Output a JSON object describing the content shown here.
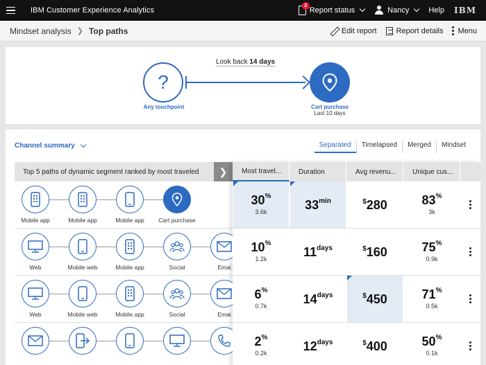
{
  "topbar": {
    "brand_prefix": "IBM",
    "brand_name": "Customer Experience Analytics",
    "report_status": "Report status",
    "report_badge": "2",
    "user": "Nancy",
    "help": "Help",
    "logo": "IBM"
  },
  "subbar": {
    "crumb_parent": "Mindset analysis",
    "crumb_current": "Top paths",
    "edit_report": "Edit report",
    "report_details": "Report details",
    "menu": "Menu"
  },
  "config": {
    "lookback_prefix": "Look back",
    "lookback_value": "14 days",
    "start_label": "Any touchpoint",
    "start_symbol": "?",
    "end_label": "Cart purchase",
    "end_sub": "Last 10 days"
  },
  "summary": {
    "title": "Channel summary",
    "views": [
      "Separated",
      "Timelapsed",
      "Merged",
      "Mindset"
    ],
    "left_header": "Top 5 paths of dynamic segment ranked by most traveled",
    "columns": [
      "Most travel...",
      "Duration",
      "Avg revenu...",
      "Unique cus..."
    ],
    "paths": [
      {
        "nodes": [
          {
            "label": "Mobile app",
            "icon": "mobile-icon"
          },
          {
            "label": "Mobile app",
            "icon": "mobile-icon"
          },
          {
            "label": "Mobile app",
            "icon": "phone-icon"
          },
          {
            "label": "Cart purchase",
            "icon": "location-pin-icon"
          }
        ],
        "traveled": "30",
        "traveled_unit": "%",
        "traveled_count": "3.6k",
        "duration": "33",
        "duration_unit": "min",
        "revenue_cur": "$",
        "revenue": "280",
        "unique": "83",
        "unique_unit": "%",
        "unique_count": "3k"
      },
      {
        "nodes": [
          {
            "label": "Web",
            "icon": "monitor-icon"
          },
          {
            "label": "Mobile web",
            "icon": "phone-icon"
          },
          {
            "label": "Mobile app",
            "icon": "mobile-icon"
          },
          {
            "label": "Social",
            "icon": "people-icon"
          },
          {
            "label": "Emai",
            "icon": "envelope-icon"
          }
        ],
        "traveled": "10",
        "traveled_unit": "%",
        "traveled_count": "1.2k",
        "duration": "11",
        "duration_unit": "days",
        "revenue_cur": "$",
        "revenue": "160",
        "unique": "75",
        "unique_unit": "%",
        "unique_count": "0.9k"
      },
      {
        "nodes": [
          {
            "label": "Web",
            "icon": "monitor-icon"
          },
          {
            "label": "Mobile web",
            "icon": "phone-icon"
          },
          {
            "label": "Mobile app",
            "icon": "mobile-icon"
          },
          {
            "label": "Social",
            "icon": "people-icon"
          },
          {
            "label": "Emai",
            "icon": "envelope-icon"
          }
        ],
        "traveled": "6",
        "traveled_unit": "%",
        "traveled_count": "0.7k",
        "duration": "14",
        "duration_unit": "days",
        "revenue_cur": "$",
        "revenue": "450",
        "unique": "71",
        "unique_unit": "%",
        "unique_count": "0.5k"
      },
      {
        "nodes": [
          {
            "label": "",
            "icon": "envelope-icon"
          },
          {
            "label": "",
            "icon": "phone-exit-icon"
          },
          {
            "label": "",
            "icon": "phone-icon"
          },
          {
            "label": "",
            "icon": "monitor-icon"
          },
          {
            "label": "",
            "icon": "telephone-icon"
          }
        ],
        "traveled": "2",
        "traveled_unit": "%",
        "traveled_count": "0.2k",
        "duration": "12",
        "duration_unit": "days",
        "revenue_cur": "$",
        "revenue": "400",
        "unique": "50",
        "unique_unit": "%",
        "unique_count": "0.1k"
      }
    ],
    "highlights": [
      [
        "traveled",
        "duration"
      ],
      [],
      [
        "revenue"
      ],
      []
    ]
  },
  "colors": {
    "accent": "#2d6ac1",
    "topbar": "#121212",
    "highlight": "#e3ebf5"
  }
}
